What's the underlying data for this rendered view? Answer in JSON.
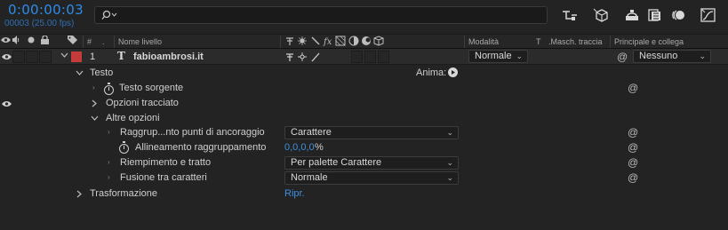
{
  "header": {
    "timecode": "0:00:00:03",
    "frames_fps": "00003 (25.00 fps)",
    "search_placeholder": ""
  },
  "columns": {
    "hash": "#",
    "layer_name": "Nome livello",
    "mode": "Modalità",
    "t": "T",
    "track_matte": ".Masch. traccia",
    "parent": "Principale e collega"
  },
  "layer": {
    "number": "1",
    "type_icon": "T",
    "name": "fabioambrosi.it",
    "label_color": "#c33b3b",
    "mode": "Normale",
    "parent": "Nessuno"
  },
  "properties": {
    "testo": "Testo",
    "anima": "Anima:",
    "testo_sorgente": "Testo sorgente",
    "opzioni_tracciato": "Opzioni tracciato",
    "altre_opzioni": "Altre opzioni",
    "raggruppamento_label": "Raggrup...nto punti di ancoraggio",
    "raggruppamento_value": "Carattere",
    "allineamento_label": "Allineamento raggruppamento",
    "allineamento_value": "0,0,0,0",
    "allineamento_unit": "%",
    "riempimento_label": "Riempimento e tratto",
    "riempimento_value": "Per palette Carattere",
    "fusione_label": "Fusione tra caratteri",
    "fusione_value": "Normale",
    "trasformazione": "Trasformazione",
    "ripr": "Ripr."
  },
  "colors": {
    "accent_blue": "#2d8ceb",
    "background": "#232323",
    "layer_row": "#2b2b2b"
  }
}
